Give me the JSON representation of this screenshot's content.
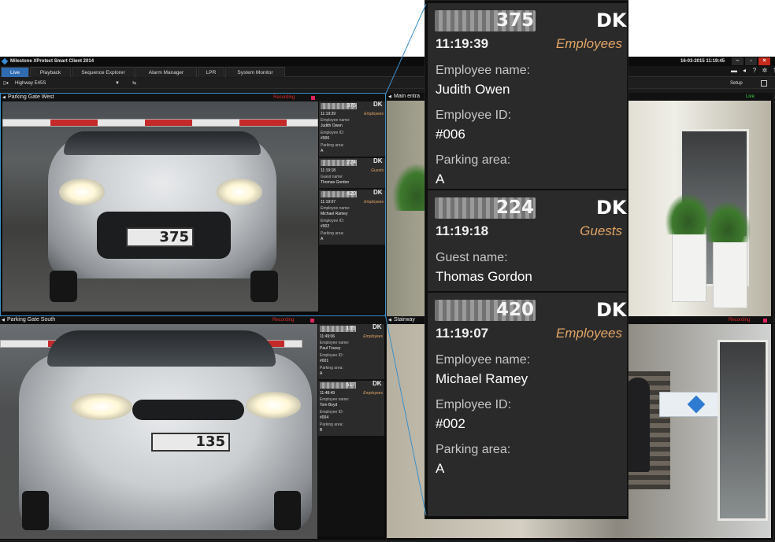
{
  "window": {
    "title": "Milestone XProtect Smart Client 2014",
    "clock": "16-03-2015 11:19:45",
    "controls": [
      "minimize",
      "restore",
      "close"
    ]
  },
  "tabs": [
    {
      "label": "Live",
      "active": true
    },
    {
      "label": "Playback"
    },
    {
      "label": "Sequence Explorer"
    },
    {
      "label": "Alarm Manager"
    },
    {
      "label": "LPR"
    },
    {
      "label": "System Monitor"
    }
  ],
  "toolbar": {
    "view_name": "Highway E45S",
    "setup_label": "Setup"
  },
  "panes": {
    "west": {
      "name": "Parking Gate West",
      "status": "Recording"
    },
    "south": {
      "name": "Parking Gate South",
      "status": "Recording"
    },
    "entrance": {
      "name": "Main entra",
      "status": "Live"
    },
    "stairway": {
      "name": "Stairway",
      "status": "Recording"
    }
  },
  "scene_plates": {
    "west": "375",
    "south": "135"
  },
  "west_lpr": [
    {
      "plate": "375",
      "country": "DK",
      "time": "11:19:39",
      "group": "Employees",
      "fields": [
        [
          "Employee name:",
          "Judith Owen"
        ],
        [
          "Employee ID:",
          "#006"
        ],
        [
          "Parking area:",
          "A"
        ]
      ]
    },
    {
      "plate": "224",
      "country": "DK",
      "time": "11:19:18",
      "group": "Guests",
      "fields": [
        [
          "Guest name:",
          "Thomas Gordon"
        ]
      ]
    },
    {
      "plate": "420",
      "country": "DK",
      "time": "11:19:07",
      "group": "Employees",
      "fields": [
        [
          "Employee name:",
          "Michael Ramey"
        ],
        [
          "Employee ID:",
          "#002"
        ],
        [
          "Parking area:",
          "A"
        ]
      ]
    }
  ],
  "south_lpr": [
    {
      "plate": "135",
      "country": "DK",
      "time": "11:49:06",
      "group": "Employees",
      "fields": [
        [
          "Employee name:",
          "Paul Tracey"
        ],
        [
          "Employee ID:",
          "#001"
        ],
        [
          "Parking area:",
          "A"
        ]
      ]
    },
    {
      "plate": "517",
      "country": "DK",
      "time": "11:48:49",
      "group": "Employees",
      "fields": [
        [
          "Employee name:",
          "Tom Boyd"
        ],
        [
          "Employee ID:",
          "#004"
        ],
        [
          "Parking area:",
          "B"
        ]
      ]
    }
  ],
  "callout": [
    {
      "plate": "375",
      "country": "DK",
      "time": "11:19:39",
      "group": "Employees",
      "fields": [
        [
          "Employee name:",
          "Judith Owen"
        ],
        [
          "Employee ID:",
          "#006"
        ],
        [
          "Parking area:",
          "A"
        ]
      ]
    },
    {
      "plate": "224",
      "country": "DK",
      "time": "11:19:18",
      "group": "Guests",
      "fields": [
        [
          "Guest name:",
          "Thomas Gordon"
        ]
      ]
    },
    {
      "plate": "420",
      "country": "DK",
      "time": "11:19:07",
      "group": "Employees",
      "fields": [
        [
          "Employee name:",
          "Michael Ramey"
        ],
        [
          "Employee ID:",
          "#002"
        ],
        [
          "Parking area:",
          "A"
        ]
      ]
    }
  ],
  "colors": {
    "accent": "#2f6bb0",
    "recording": "#e02a2a",
    "live": "#3ad04a",
    "group_label": "#e2a566"
  },
  "icons": [
    "app-icon",
    "view-layout-icon",
    "dropdown-arrow-icon",
    "link-icon",
    "maximize-icon",
    "help-icon",
    "settings-icon",
    "status-icon",
    "connection-icon"
  ]
}
